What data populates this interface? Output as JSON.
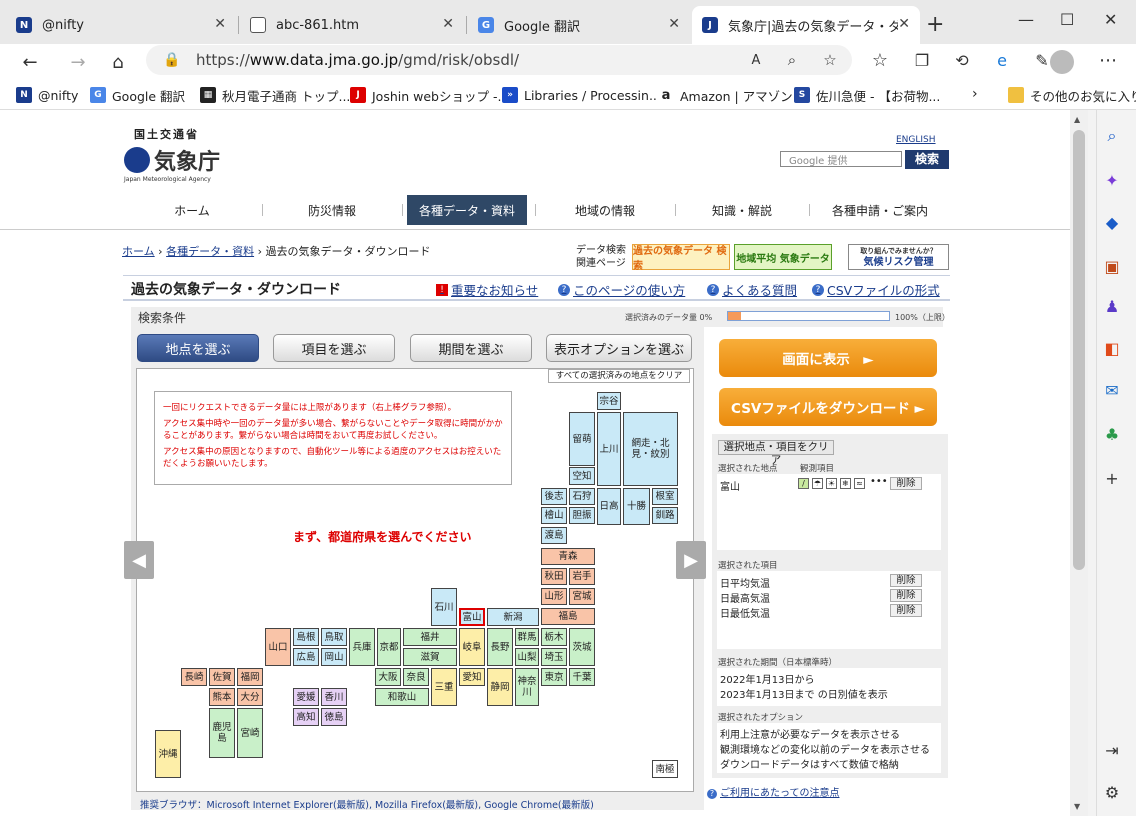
{
  "browser": {
    "tabs": [
      {
        "title": "@nifty"
      },
      {
        "title": "abc-861.htm"
      },
      {
        "title": "Google 翻訳"
      },
      {
        "title": "気象庁|過去の気象データ・ダウン"
      }
    ],
    "url_prefix": "https://",
    "url_host": "www.data.jma.go.jp",
    "url_path": "/gmd/risk/obsdl/",
    "bookmarks": [
      "@nifty",
      "Google 翻訳",
      "秋月電子通商 トップ...",
      "Joshin webショップ -...",
      "Libraries / Processin...",
      "Amazon | アマゾン",
      "佐川急便 - 【お荷物...",
      "その他のお気に入り"
    ]
  },
  "header": {
    "ministry": "国土交通省",
    "agency": "気象庁",
    "agency_en": "Japan Meteorological Agency",
    "english_link": "ENGLISH",
    "search_placeholder": "Google 提供",
    "search_button": "検索"
  },
  "gnav": [
    "ホーム",
    "防災情報",
    "各種データ・資料",
    "地域の情報",
    "知識・解説",
    "各種申請・ご案内"
  ],
  "breadcrumb": {
    "home": "ホーム",
    "sep": "›",
    "data": "各種データ・資料",
    "current": "過去の気象データ・ダウンロード"
  },
  "related": {
    "label1": "データ検索",
    "label2": "関連ページ",
    "banner1": "過去の気象データ 検索",
    "banner2": "地域平均 気象データ",
    "banner3": "気候リスク管理",
    "banner3_sub": "取り組んでみませんか？"
  },
  "title": "過去の気象データ・ダウンロード",
  "toplinks": [
    "重要なお知らせ",
    "このページの使い方",
    "よくある質問",
    "CSVファイルの形式"
  ],
  "conditions": {
    "label": "検索条件",
    "count_label": "選択済みのデータ量 0%",
    "max_label": "100%（上限）",
    "progress": 0.08
  },
  "tabs": [
    "地点を選ぶ",
    "項目を選ぶ",
    "期間を選ぶ",
    "表示オプションを選ぶ"
  ],
  "map": {
    "clear_all": "すべての選択済みの地点をクリア",
    "notice": [
      "一回にリクエストできるデータ量には上限があります（右上棒グラフ参照）。",
      "アクセス集中時や一回のデータ量が多い場合、繋がらないことやデータ取得に時間がかかることがあります。繋がらない場合は時間をおいて再度お試しください。",
      "アクセス集中の原因となりますので、自動化ツール等による過度のアクセスはお控えいただくようお願いいたします。"
    ],
    "choose_msg": "まず、都道府県を選んでください",
    "prefectures": [
      "宗谷",
      "留萌",
      "上川",
      "網走・北見・紋別",
      "空知",
      "後志",
      "石狩",
      "日高",
      "十勝",
      "根室",
      "檜山",
      "胆振",
      "釧路",
      "渡島",
      "青森",
      "秋田",
      "岩手",
      "山形",
      "宮城",
      "福島",
      "石川",
      "富山",
      "新潟",
      "福井",
      "岐阜",
      "長野",
      "群馬",
      "栃木",
      "茨城",
      "山口",
      "島根",
      "鳥取",
      "兵庫",
      "京都",
      "滋賀",
      "山梨",
      "埼玉",
      "広島",
      "岡山",
      "大阪",
      "奈良",
      "三重",
      "愛知",
      "静岡",
      "神奈川",
      "東京",
      "千葉",
      "長崎",
      "佐賀",
      "福岡",
      "愛媛",
      "香川",
      "和歌山",
      "熊本",
      "大分",
      "高知",
      "徳島",
      "鹿児島",
      "宮崎",
      "沖縄",
      "南極"
    ]
  },
  "browser_recommend": "推奨ブラウザ：Microsoft Internet Explorer(最新版), Mozilla Firefox(最新版), Google Chrome(最新版)",
  "right": {
    "show_button": "画面に表示　►",
    "csv_button": "CSVファイルをダウンロード ►",
    "clear_button": "選択地点・項目をクリア",
    "selected_points_label": "選択された地点",
    "obs_items_label": "観測項目",
    "point": "富山",
    "delete": "削除",
    "selected_items_label": "選択された項目",
    "items": [
      "日平均気温",
      "日最高気温",
      "日最低気温"
    ],
    "period_label": "選択された期間（日本標準時）",
    "period_from": "2022年1月13日から",
    "period_to": "2023年1月13日まで の日別値を表示",
    "options_label": "選択されたオプション",
    "options": [
      "利用上注意が必要なデータを表示させる",
      "観測環境などの変化以前のデータを表示させる",
      "ダウンロードデータはすべて数値で格納"
    ],
    "caution_link": "ご利用にあたっての注意点"
  },
  "colors": {
    "nav_active": "#2f4866",
    "orange": "#ea8a0c",
    "link": "#1a3c8c"
  }
}
